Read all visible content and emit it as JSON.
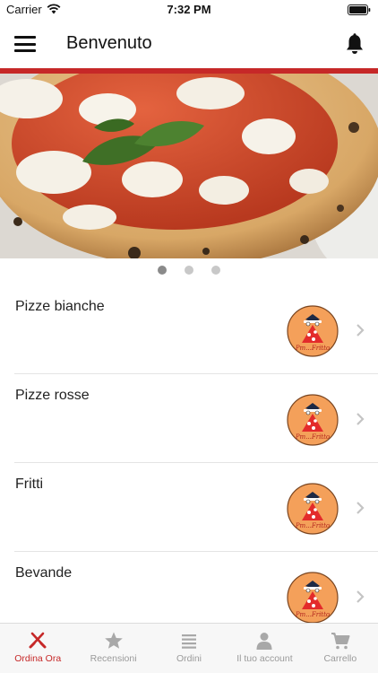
{
  "status_bar": {
    "carrier": "Carrier",
    "time": "7:32 PM"
  },
  "header": {
    "title": "Benvenuto",
    "accent_color": "#c62828"
  },
  "carousel": {
    "slide_count": 3,
    "active_index": 0
  },
  "categories": [
    {
      "label": "Pizze bianche"
    },
    {
      "label": "Pizze rosse"
    },
    {
      "label": "Fritti"
    },
    {
      "label": "Bevande"
    }
  ],
  "logo": {
    "text": "Pm...Fritto",
    "background": "#f4a05a"
  },
  "tab_bar": {
    "active_color": "#c62828",
    "inactive_color": "#9a9a9a",
    "tabs": [
      {
        "label": "Ordina Ora",
        "icon": "utensils-icon",
        "active": true
      },
      {
        "label": "Recensioni",
        "icon": "star-icon",
        "active": false
      },
      {
        "label": "Ordini",
        "icon": "list-icon",
        "active": false
      },
      {
        "label": "Il tuo account",
        "icon": "user-icon",
        "active": false
      },
      {
        "label": "Carrello",
        "icon": "cart-icon",
        "active": false
      }
    ]
  }
}
